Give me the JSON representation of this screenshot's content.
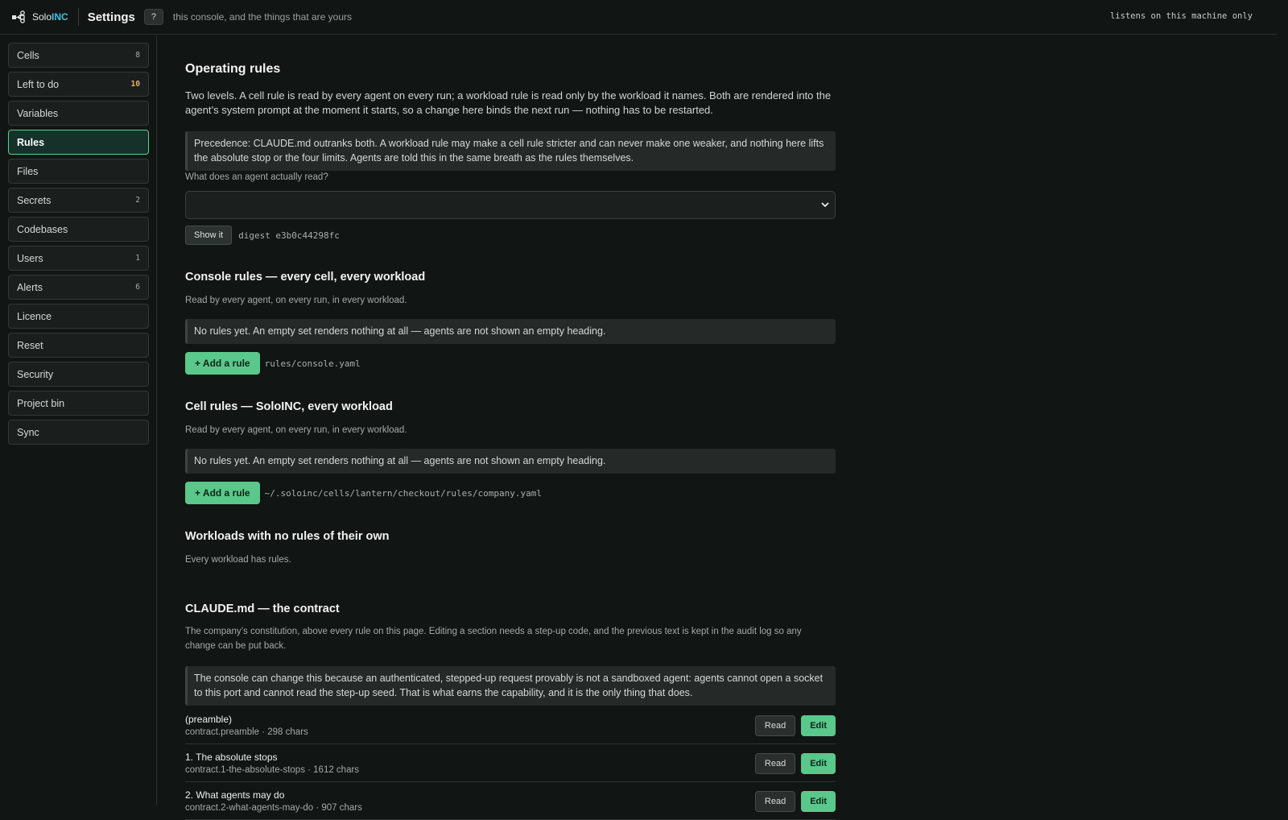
{
  "topbar": {
    "brand_prefix": "Solo",
    "brand_accent": "INC",
    "title": "Settings",
    "help_label": "?",
    "tagline": "this console, and the things that are yours",
    "status": "listens on this machine only"
  },
  "sidebar": {
    "items": [
      {
        "label": "Cells",
        "count": "8"
      },
      {
        "label": "Left to do",
        "count": "10"
      },
      {
        "label": "Variables",
        "count": ""
      },
      {
        "label": "Rules",
        "count": ""
      },
      {
        "label": "Files",
        "count": ""
      },
      {
        "label": "Secrets",
        "count": "2"
      },
      {
        "label": "Codebases",
        "count": ""
      },
      {
        "label": "Users",
        "count": "1"
      },
      {
        "label": "Alerts",
        "count": "6"
      },
      {
        "label": "Licence",
        "count": ""
      },
      {
        "label": "Reset",
        "count": ""
      },
      {
        "label": "Security",
        "count": ""
      },
      {
        "label": "Project bin",
        "count": ""
      },
      {
        "label": "Sync",
        "count": ""
      }
    ],
    "active": "Rules"
  },
  "operating": {
    "title": "Operating rules",
    "lead": "Two levels. A cell rule is read by every agent on every run; a workload rule is read only by the workload it names. Both are rendered into the agent’s system prompt at the moment it starts, so a change here binds the next run — nothing has to be restarted.",
    "precedence": "Precedence: CLAUDE.md outranks both. A workload rule may make a cell rule stricter and can never make one weaker, and nothing here lifts the absolute stop or the four limits. Agents are told this in the same breath as the rules themselves.",
    "select_label": "What does an agent actually read?",
    "select_value": "",
    "show_button": "Show it",
    "digest": "digest e3b0c44298fc"
  },
  "console_rules": {
    "title": "Console rules — every cell, every workload",
    "subtitle": "Read by every agent, on every run, in every workload.",
    "empty": "No rules yet. An empty set renders nothing at all — agents are not shown an empty heading.",
    "add_button": "+ Add a rule",
    "path": "rules/console.yaml"
  },
  "cell_rules": {
    "title": "Cell rules — SoloINC, every workload",
    "subtitle": "Read by every agent, on every run, in every workload.",
    "empty": "No rules yet. An empty set renders nothing at all — agents are not shown an empty heading.",
    "add_button": "+ Add a rule",
    "path": "~/.soloinc/cells/lantern/checkout/rules/company.yaml"
  },
  "workloads": {
    "title": "Workloads with no rules of their own",
    "subtitle": "Every workload has rules."
  },
  "contract": {
    "title": "CLAUDE.md — the contract",
    "subtitle": "The company’s constitution, above every rule on this page. Editing a section needs a step-up code, and the previous text is kept in the audit log so any change can be put back.",
    "note": "The console can change this because an authenticated, stepped-up request provably is not a sandboxed agent: agents cannot open a socket to this port and cannot read the step-up seed. That is what earns the capability, and it is the only thing that does.",
    "read_label": "Read",
    "edit_label": "Edit",
    "sections": [
      {
        "name": "(preamble)",
        "meta": "contract.preamble · 298 chars"
      },
      {
        "name": "1. The absolute stops",
        "meta": "contract.1-the-absolute-stops · 1612 chars"
      },
      {
        "name": "2. What agents may do",
        "meta": "contract.2-what-agents-may-do · 907 chars"
      }
    ]
  }
}
